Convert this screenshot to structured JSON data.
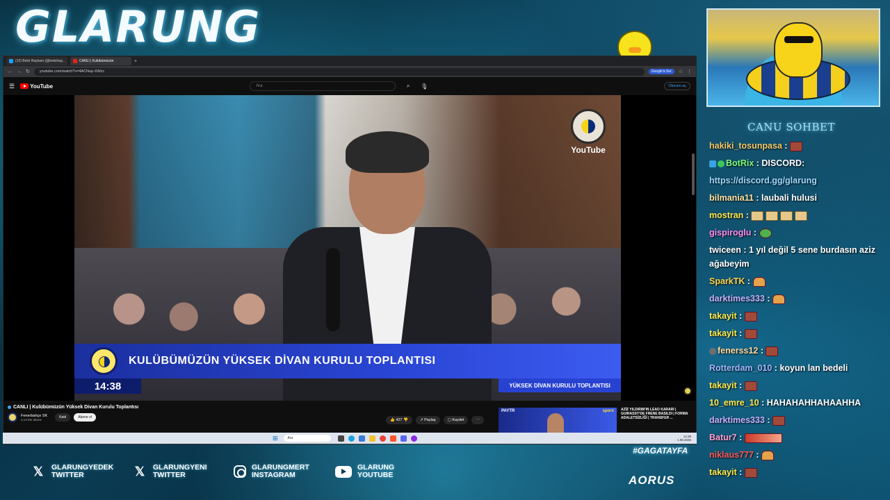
{
  "overlay": {
    "title": "GLARUNG",
    "hashtag": "#GAGATAYFA",
    "sponsor": "AORUS"
  },
  "browser": {
    "tabs": [
      {
        "label": "(10) Bekir Baykam (@bekirbay...",
        "icon": "x-favicon"
      },
      {
        "label": "CANLI | Kulübümüzün",
        "icon": "youtube-favicon"
      }
    ],
    "url": "youtube.com/watch?v=4ACNup-XWzc",
    "google_button": "Google'a Sor"
  },
  "youtube": {
    "logo": "YouTube",
    "search_placeholder": "Ara",
    "signin": "Oturum aç",
    "watermark": "YouTube",
    "lower_third_title": "KULÜBÜMÜZÜN YÜKSEK DİVAN KURULU TOPLANTISI",
    "lower_third_time": "14:38",
    "lower_third_sub": "YÜKSEK DİVAN KURULU TOPLANTISI",
    "video_title": "CANLI | Kulübümüzün Yüksek Divan Kurulu Toplantısı",
    "channel_name": "Fenerbahçe SK",
    "channel_subs": "3,13 Mn abone",
    "join_label": "Katıl",
    "subscribe_label": "Abone ol",
    "likes": "427",
    "share_label": "Paylaş",
    "save_label": "Kaydet",
    "rec_label": "PAYTR",
    "rec_brand": "sporx",
    "rec_title": "AZİZ YILDIRIM'IN LEAO KARARI | GUIRASSY'DE FRENE BASILDI | FORMA ADALETSİZLİĞİ | TRANSFER ..."
  },
  "taskbar": {
    "search": "Ara",
    "time": "14:38",
    "date": "1.08.2026"
  },
  "chat": {
    "header": "CANU SOHBET",
    "messages": [
      {
        "user": "hakiki_tosunpasa",
        "color": "#f5c96a",
        "text": "",
        "emotes": [
          "emote"
        ]
      },
      {
        "user": "BotRix",
        "color": "#7cff7c",
        "text": "DISCORD:",
        "badges": [
          "blue",
          "green"
        ]
      },
      {
        "user": "",
        "color": "#ffffff",
        "text": "https://discord.gg/glarung",
        "link": true
      },
      {
        "user": "bilmania11",
        "color": "#ffe0a0",
        "text": "laubali hulusi"
      },
      {
        "user": "mostran",
        "color": "#ffe94a",
        "text": "",
        "emotes": [
          "face",
          "face",
          "face",
          "face"
        ]
      },
      {
        "user": "gispiroglu",
        "color": "#ff8af0",
        "text": "",
        "emotes": [
          "frog"
        ]
      },
      {
        "user": "twiceen",
        "color": "#ffffff",
        "text": "1 yıl değil 5 sene burdasın aziz ağabeyim"
      },
      {
        "user": "SparkTK",
        "color": "#ffd34a",
        "text": "",
        "emotes": [
          "hand"
        ]
      },
      {
        "user": "darktimes333",
        "color": "#c6b2ff",
        "text": "",
        "emotes": [
          "hand"
        ]
      },
      {
        "user": "takayit",
        "color": "#ffe94a",
        "text": "",
        "emotes": [
          "emote"
        ]
      },
      {
        "user": "takayit",
        "color": "#ffe94a",
        "text": "",
        "emotes": [
          "emote"
        ]
      },
      {
        "user": "fenerss12",
        "color": "#ffd9a0",
        "text": "",
        "emotes": [
          "emote"
        ],
        "badges": [
          "dark"
        ]
      },
      {
        "user": "Rotterdam_010",
        "color": "#a0b8ff",
        "text": "koyun lan bedeli"
      },
      {
        "user": "takayit",
        "color": "#ffe94a",
        "text": "",
        "emotes": [
          "emote"
        ]
      },
      {
        "user": "10_emre_10",
        "color": "#ffe94a",
        "text": "HAHAHAHHAHAAHHA"
      },
      {
        "user": "darktimes333",
        "color": "#c6b2ff",
        "text": "",
        "emotes": [
          "emote"
        ]
      },
      {
        "user": "Batur7",
        "color": "#ff9fd0",
        "text": "",
        "emotes": [
          "wide"
        ]
      },
      {
        "user": "niklaus777",
        "color": "#ff5a5a",
        "text": "",
        "emotes": [
          "hand"
        ]
      },
      {
        "user": "takayit",
        "color": "#ffe94a",
        "text": "",
        "emotes": [
          "emote"
        ]
      }
    ]
  },
  "socials": [
    {
      "icon": "x-icon",
      "line1": "GLARUNGYEDEK",
      "line2": "TWITTER"
    },
    {
      "icon": "x-icon",
      "line1": "GLARUNGYENI",
      "line2": "TWITTER"
    },
    {
      "icon": "instagram-icon",
      "line1": "GLARUNGMERT",
      "line2": "INSTAGRAM"
    },
    {
      "icon": "youtube-icon",
      "line1": "GLARUNG",
      "line2": "YOUTUBE"
    }
  ]
}
